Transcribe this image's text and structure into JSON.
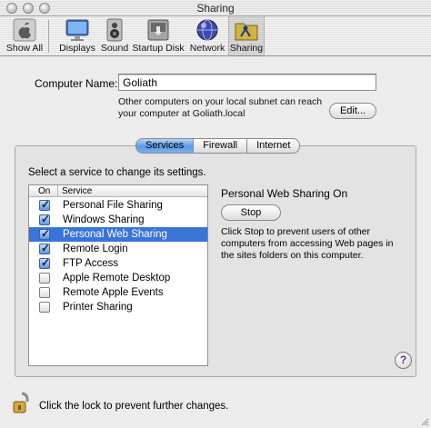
{
  "window": {
    "title": "Sharing"
  },
  "toolbar": {
    "items": [
      {
        "label": "Show All",
        "icon": "apple-icon"
      },
      {
        "label": "Displays",
        "icon": "display-icon"
      },
      {
        "label": "Sound",
        "icon": "speaker-icon"
      },
      {
        "label": "Startup Disk",
        "icon": "disk-icon"
      },
      {
        "label": "Network",
        "icon": "network-globe-icon"
      },
      {
        "label": "Sharing",
        "icon": "sharing-folder-icon",
        "selected": true
      }
    ]
  },
  "computer": {
    "name_label": "Computer Name:",
    "name_value": "Goliath",
    "subnet_text": "Other computers on your local subnet can reach your computer at Goliath.local",
    "edit_label": "Edit..."
  },
  "tabs": [
    {
      "label": "Services",
      "active": true
    },
    {
      "label": "Firewall",
      "active": false
    },
    {
      "label": "Internet",
      "active": false
    }
  ],
  "services": {
    "prompt": "Select a service to change its settings.",
    "col_on": "On",
    "col_service": "Service",
    "rows": [
      {
        "name": "Personal File Sharing",
        "on": true,
        "selected": false
      },
      {
        "name": "Windows Sharing",
        "on": true,
        "selected": false
      },
      {
        "name": "Personal Web Sharing",
        "on": true,
        "selected": true
      },
      {
        "name": "Remote Login",
        "on": true,
        "selected": false
      },
      {
        "name": "FTP Access",
        "on": true,
        "selected": false
      },
      {
        "name": "Apple Remote Desktop",
        "on": false,
        "selected": false
      },
      {
        "name": "Remote Apple Events",
        "on": false,
        "selected": false
      },
      {
        "name": "Printer Sharing",
        "on": false,
        "selected": false
      }
    ],
    "status_title": "Personal Web Sharing On",
    "stop_label": "Stop",
    "status_desc": "Click Stop to prevent users of other computers from accessing Web pages in the sites folders on this computer.",
    "help_label": "?"
  },
  "footer": {
    "lock_text": "Click the lock to prevent further changes."
  },
  "colors": {
    "selection": "#3875d7",
    "tab_active": "#5a9ae6",
    "check": "#5a96e0"
  }
}
